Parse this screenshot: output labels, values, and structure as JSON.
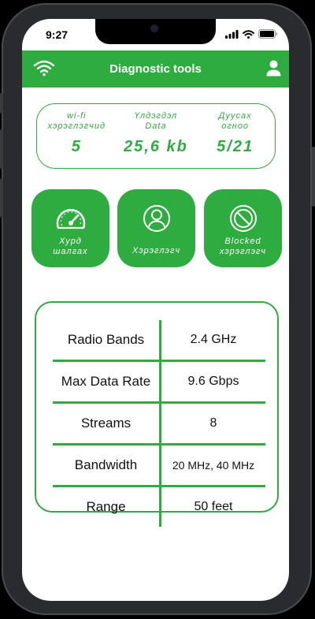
{
  "status_bar": {
    "time": "9:27"
  },
  "header": {
    "title": "Diagnostic tools",
    "left_icon": "wifi-icon",
    "right_icon": "user-icon"
  },
  "stats": [
    {
      "label": "wi-fi\nхэрэглэгчид",
      "value": "5"
    },
    {
      "label": "Үлдэгдэл\nData",
      "value": "25,6 kb"
    },
    {
      "label": "Дуусах\nогноо",
      "value": "5/21"
    }
  ],
  "tools": [
    {
      "label": "Хурд\nшалгах",
      "icon": "speedometer-icon"
    },
    {
      "label": "Хэрэглэгч",
      "icon": "user-circle-icon"
    },
    {
      "label": "Blocked\nхэрэглэгч",
      "icon": "blocked-icon"
    }
  ],
  "specs": [
    {
      "name": "Radio Bands",
      "value": "2.4 GHz"
    },
    {
      "name": "Max Data Rate",
      "value": "9.6 Gbps"
    },
    {
      "name": "Streams",
      "value": "8"
    },
    {
      "name": "Bandwidth",
      "value": "20 MHz, 40 MHz"
    },
    {
      "name": "Range",
      "value": "50 feet"
    }
  ],
  "colors": {
    "accent": "#2eac3f",
    "frame": "#2a2b2e"
  }
}
